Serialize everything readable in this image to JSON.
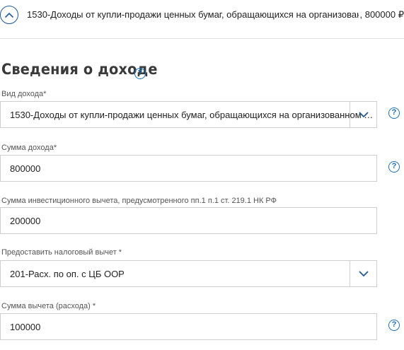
{
  "item_header": {
    "title": "1530-Доходы от купли-продажи ценных бумаг, обращающихся на организованном …",
    "amount": ", 800000 ₽"
  },
  "section": {
    "title": "Сведения о доходе",
    "help": "?"
  },
  "form": {
    "income_type": {
      "label": "Вид дохода*",
      "value": "1530-Доходы от купли-продажи ценных бумаг, обращающихся на организованном …"
    },
    "income_amount": {
      "label": "Сумма дохода*",
      "value": "800000"
    },
    "investment_deduction": {
      "label": "Сумма инвестиционного вычета, предусмотренного пп.1 п.1 ст. 219.1 НК РФ",
      "value": "200000"
    },
    "tax_deduction": {
      "label": "Предоставить налоговый вычет *",
      "value": "201-Расх. по оп. с ЦБ ООР"
    },
    "deduction_amount": {
      "label": "Сумма вычета (расхода) *",
      "value": "100000"
    }
  },
  "help_glyph": "?"
}
